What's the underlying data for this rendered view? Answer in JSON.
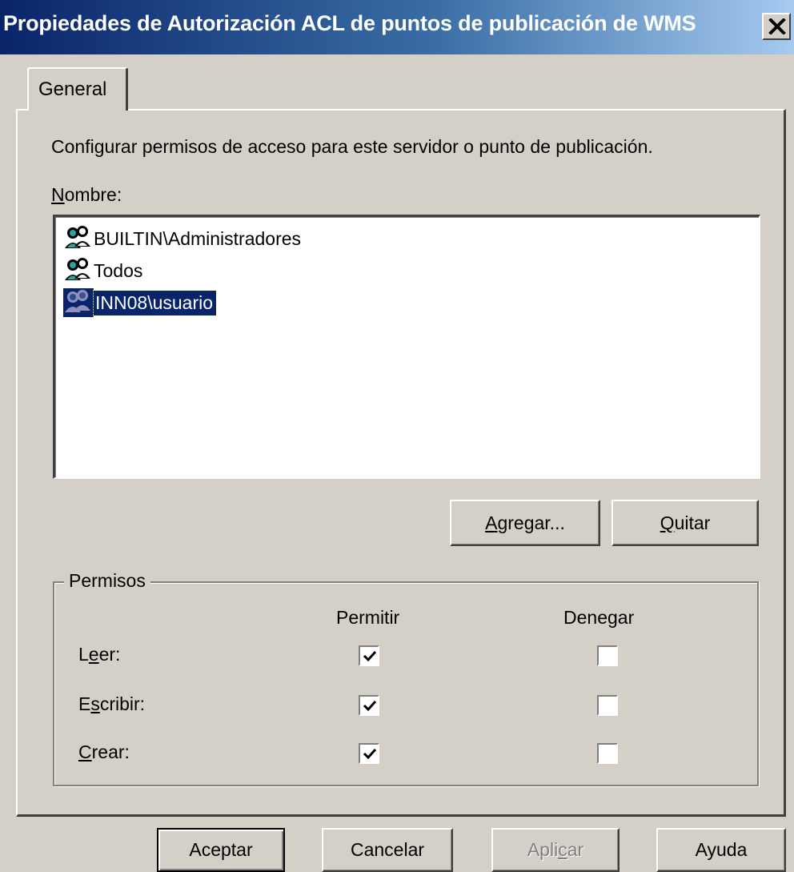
{
  "window": {
    "title": "Propiedades de Autorización ACL de puntos de publicación de WMS",
    "close_icon": "close-icon"
  },
  "tabs": [
    {
      "label": "General",
      "active": true
    }
  ],
  "general": {
    "description": "Configurar permisos de acceso para este servidor o punto de publicación.",
    "nombre_label": "Nombre:",
    "users": [
      {
        "name": "BUILTIN\\Administradores",
        "icon": "user-group-icon",
        "selected": false
      },
      {
        "name": "Todos",
        "icon": "user-group-icon",
        "selected": false
      },
      {
        "name": "INN08\\usuario",
        "icon": "user-group-icon",
        "selected": true
      }
    ],
    "buttons": {
      "agregar": "Agregar...",
      "quitar": "Quitar"
    },
    "permissions": {
      "title": "Permisos",
      "col_allow": "Permitir",
      "col_deny": "Denegar",
      "rows": [
        {
          "label": "Leer:",
          "allow": true,
          "deny": false
        },
        {
          "label": "Escribir:",
          "allow": true,
          "deny": false
        },
        {
          "label": "Crear:",
          "allow": true,
          "deny": false
        }
      ]
    }
  },
  "footer": {
    "aceptar": "Aceptar",
    "cancelar": "Cancelar",
    "aplicar": "Aplicar",
    "ayuda": "Ayuda"
  },
  "colors": {
    "title_bar_start": "#0a246a",
    "title_bar_end": "#a6caf0",
    "dialog_face": "#d4d0c8",
    "selection": "#0a246a"
  }
}
